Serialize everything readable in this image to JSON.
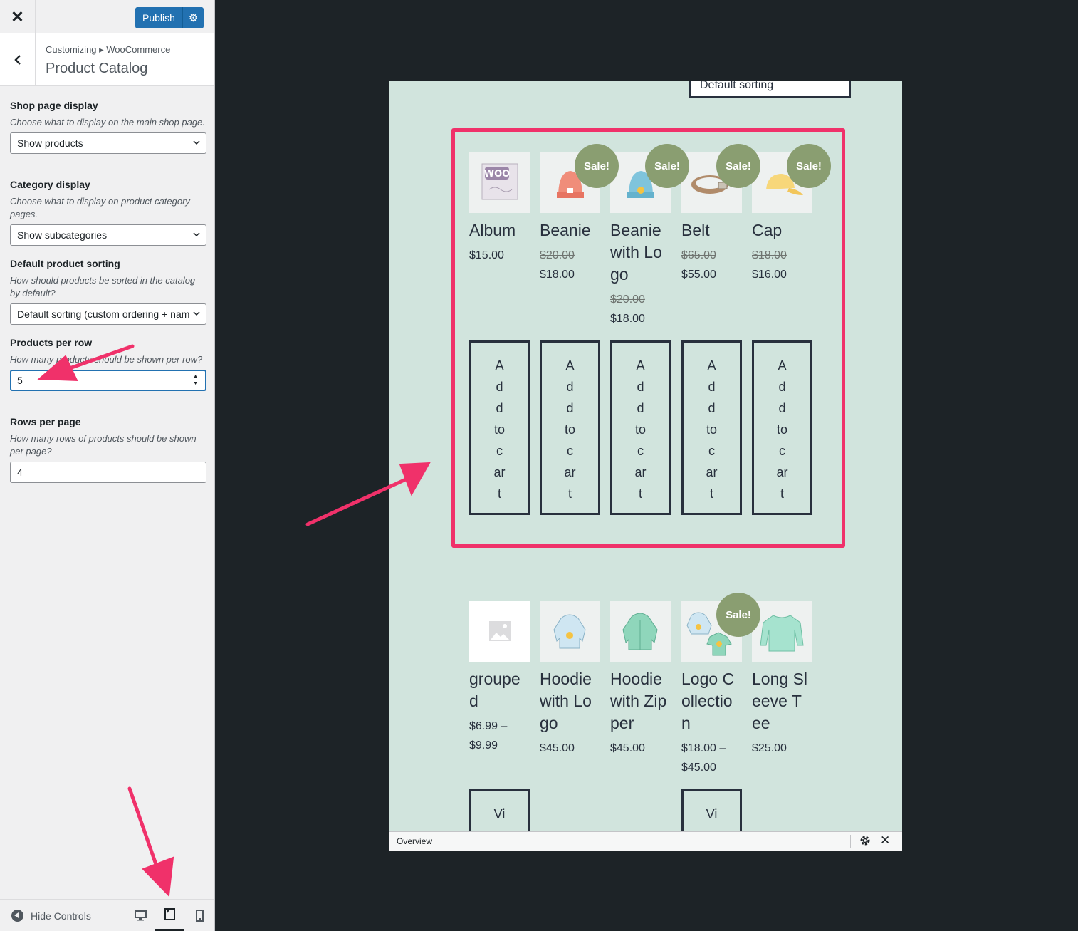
{
  "topbar": {
    "close_glyph": "✕",
    "publish_label": "Publish",
    "gear_glyph": "⚙"
  },
  "header": {
    "breadcrumb": "Customizing ▸ WooCommerce",
    "title": "Product Catalog"
  },
  "fields": {
    "shop_display": {
      "label": "Shop page display",
      "desc": "Choose what to display on the main shop page.",
      "value": "Show products"
    },
    "category_display": {
      "label": "Category display",
      "desc": "Choose what to display on product category pages.",
      "value": "Show subcategories"
    },
    "default_sorting": {
      "label": "Default product sorting",
      "desc": "How should products be sorted in the catalog by default?",
      "value": "Default sorting (custom ordering + name)"
    },
    "products_per_row": {
      "label": "Products per row",
      "desc": "How many products should be shown per row?",
      "value": "5"
    },
    "rows_per_page": {
      "label": "Rows per page",
      "desc": "How many rows of products should be shown per page?",
      "value": "4"
    }
  },
  "footer": {
    "hide_controls": "Hide Controls",
    "devices": [
      "desktop-icon",
      "tablet-icon",
      "mobile-icon"
    ],
    "active_device": "tablet"
  },
  "preview": {
    "sorting_label": "Default sorting",
    "sale_label": "Sale!",
    "row1": [
      {
        "name": "Album",
        "price": "$15.00",
        "old_price": "",
        "sale": false,
        "icon": "album-icon"
      },
      {
        "name": "Beanie",
        "price": "$18.00",
        "old_price": "$20.00",
        "sale": true,
        "icon": "beanie-icon"
      },
      {
        "name": "Beanie with Logo",
        "price": "$18.00",
        "old_price": "$20.00",
        "sale": true,
        "icon": "beanie-logo-icon"
      },
      {
        "name": "Belt",
        "price": "$55.00",
        "old_price": "$65.00",
        "sale": true,
        "icon": "belt-icon"
      },
      {
        "name": "Cap",
        "price": "$16.00",
        "old_price": "$18.00",
        "sale": true,
        "icon": "cap-icon"
      }
    ],
    "row2": [
      {
        "name": "grouped",
        "price": "$6.99 – $9.99",
        "old_price": "",
        "sale": false,
        "icon": "placeholder-image-icon"
      },
      {
        "name": "Hoodie with Logo",
        "price": "$45.00",
        "old_price": "",
        "sale": false,
        "icon": "hoodie-logo-icon"
      },
      {
        "name": "Hoodie with Zipper",
        "price": "$45.00",
        "old_price": "",
        "sale": false,
        "icon": "hoodie-zipper-icon"
      },
      {
        "name": "Logo Collection",
        "price": "$18.00 – $45.00",
        "old_price": "",
        "sale": true,
        "icon": "logo-collection-icon"
      },
      {
        "name": "Long Sleeve Tee",
        "price": "$25.00",
        "old_price": "",
        "sale": false,
        "icon": "long-sleeve-tee-icon"
      }
    ],
    "add_to_cart": "Add to cart",
    "view_label": "Vi"
  },
  "overview": {
    "label": "Overview",
    "close_glyph": "✕"
  },
  "colors": {
    "accent": "#2271b1",
    "highlight": "#f0316a",
    "sale": "#8a9e71",
    "preview_bg": "#d1e4dd"
  }
}
